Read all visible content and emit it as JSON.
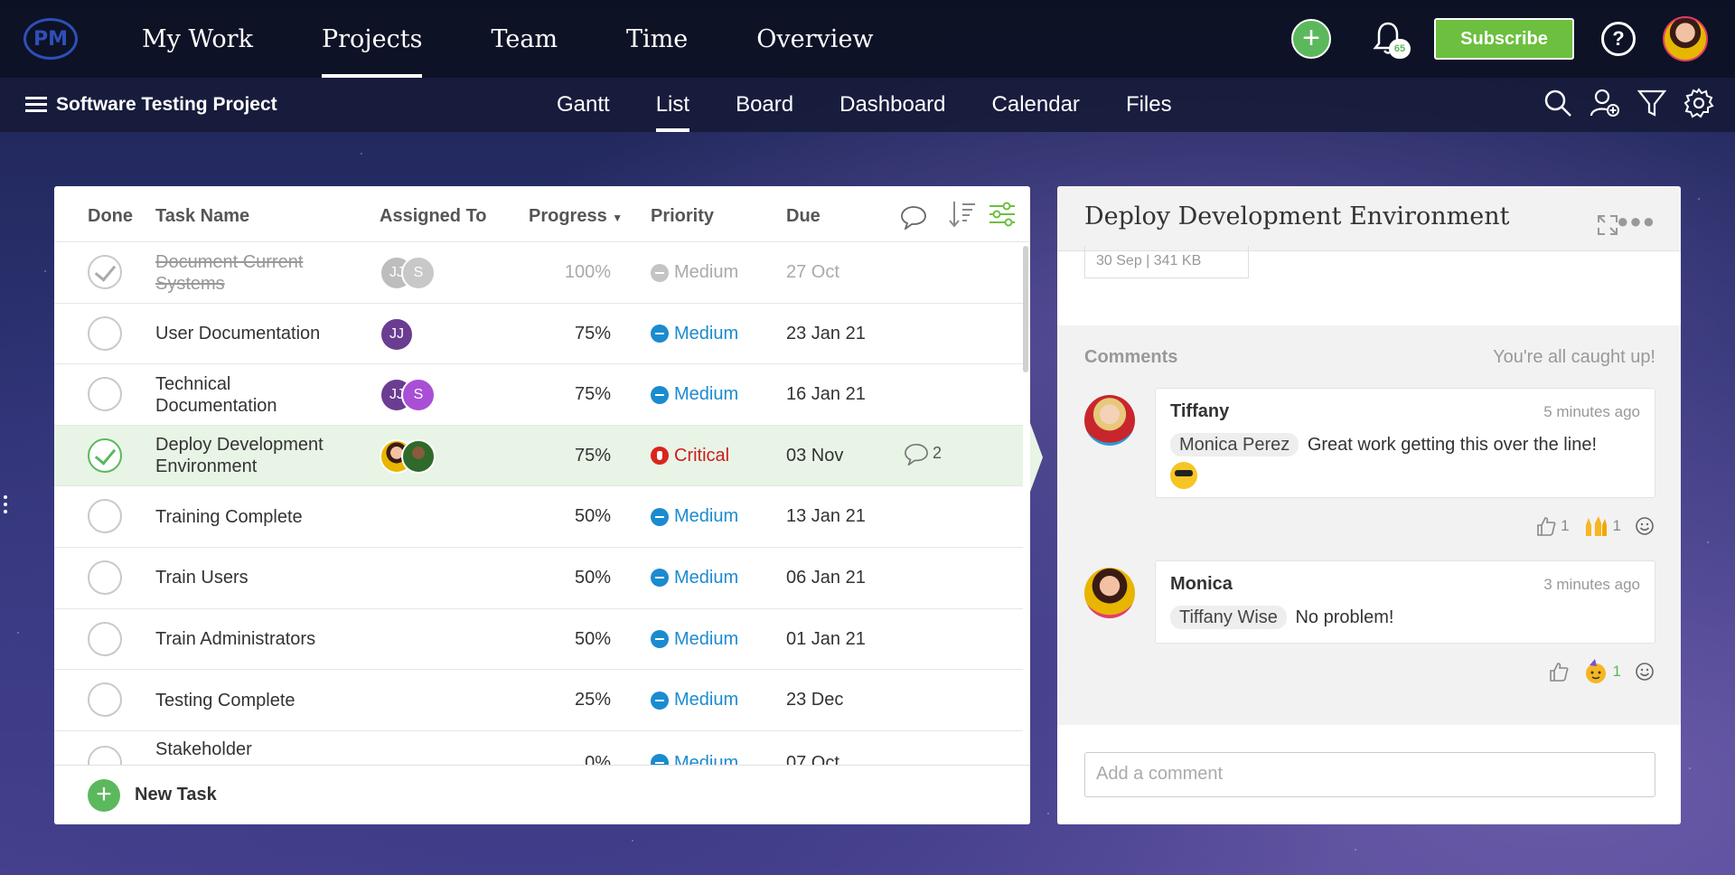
{
  "topnav": {
    "logo": "PM",
    "items": [
      {
        "label": "My Work",
        "active": false
      },
      {
        "label": "Projects",
        "active": true
      },
      {
        "label": "Team",
        "active": false
      },
      {
        "label": "Time",
        "active": false
      },
      {
        "label": "Overview",
        "active": false
      }
    ],
    "notification_count": "65",
    "subscribe_label": "Subscribe",
    "help_label": "?"
  },
  "subnav": {
    "project_name": "Software Testing Project",
    "views": [
      {
        "label": "Gantt",
        "active": false
      },
      {
        "label": "List",
        "active": true
      },
      {
        "label": "Board",
        "active": false
      },
      {
        "label": "Dashboard",
        "active": false
      },
      {
        "label": "Calendar",
        "active": false
      },
      {
        "label": "Files",
        "active": false
      }
    ]
  },
  "list": {
    "headers": {
      "done": "Done",
      "task_name": "Task Name",
      "assigned_to": "Assigned To",
      "progress": "Progress",
      "priority": "Priority",
      "due": "Due"
    },
    "rows": [
      {
        "name": "Document Current Systems",
        "done": true,
        "assignees": [
          {
            "initials": "JJ",
            "color": "#bdbdbd"
          },
          {
            "initials": "S",
            "color": "#c8c8c8"
          }
        ],
        "progress": "100%",
        "priority": "Medium",
        "due": "27 Oct",
        "completed": true
      },
      {
        "name": "User Documentation",
        "done": false,
        "assignees": [
          {
            "initials": "JJ",
            "color": "#6a3d91"
          }
        ],
        "progress": "75%",
        "priority": "Medium",
        "due": "23 Jan 21"
      },
      {
        "name": "Technical Documentation",
        "done": false,
        "assignees": [
          {
            "initials": "JJ",
            "color": "#6a3d91"
          },
          {
            "initials": "S",
            "color": "#a84fd6"
          }
        ],
        "progress": "75%",
        "priority": "Medium",
        "due": "16 Jan 21"
      },
      {
        "name": "Deploy Development Environment",
        "done": true,
        "selected": true,
        "assignees": [
          {
            "initials": "",
            "color": "#e8b500"
          },
          {
            "initials": "",
            "color": "#2f6a2a"
          }
        ],
        "progress": "75%",
        "priority": "Critical",
        "due": "03 Nov",
        "comments": "2"
      },
      {
        "name": "Training Complete",
        "done": false,
        "assignees": [],
        "progress": "50%",
        "priority": "Medium",
        "due": "13 Jan 21"
      },
      {
        "name": "Train Users",
        "done": false,
        "assignees": [],
        "progress": "50%",
        "priority": "Medium",
        "due": "06 Jan 21"
      },
      {
        "name": "Train Administrators",
        "done": false,
        "assignees": [],
        "progress": "50%",
        "priority": "Medium",
        "due": "01 Jan 21"
      },
      {
        "name": "Testing Complete",
        "done": false,
        "assignees": [],
        "progress": "25%",
        "priority": "Medium",
        "due": "23 Dec"
      },
      {
        "name": "Stakeholder",
        "done": false,
        "assignees": [],
        "progress": "0%",
        "priority": "Medium",
        "due": "07 Oct"
      }
    ],
    "new_task_label": "New Task"
  },
  "detail": {
    "title": "Deploy Development Environment",
    "attachment_meta": "30 Sep | 341 KB",
    "comments_label": "Comments",
    "caught_up": "You're all caught up!",
    "comments": [
      {
        "author": "Tiffany",
        "time": "5 minutes ago",
        "mention": "Monica  Perez",
        "text": "Great work getting this over the line!",
        "reactions": [
          {
            "icon": "thumbs-up-icon",
            "count": "1"
          },
          {
            "icon": "raised-hands-icon",
            "count": "1"
          }
        ]
      },
      {
        "author": "Monica",
        "time": "3 minutes ago",
        "mention": "Tiffany Wise",
        "text": "No problem!",
        "reactions": [
          {
            "icon": "thumbs-up-icon",
            "count": ""
          },
          {
            "icon": "party-face-icon",
            "count": "1"
          }
        ]
      }
    ],
    "add_comment_placeholder": "Add a comment"
  },
  "colors": {
    "accent_green": "#5cb85c",
    "medium_blue": "#1b8bd0",
    "critical_red": "#d9261c",
    "selected_row": "#e8f4e6"
  }
}
